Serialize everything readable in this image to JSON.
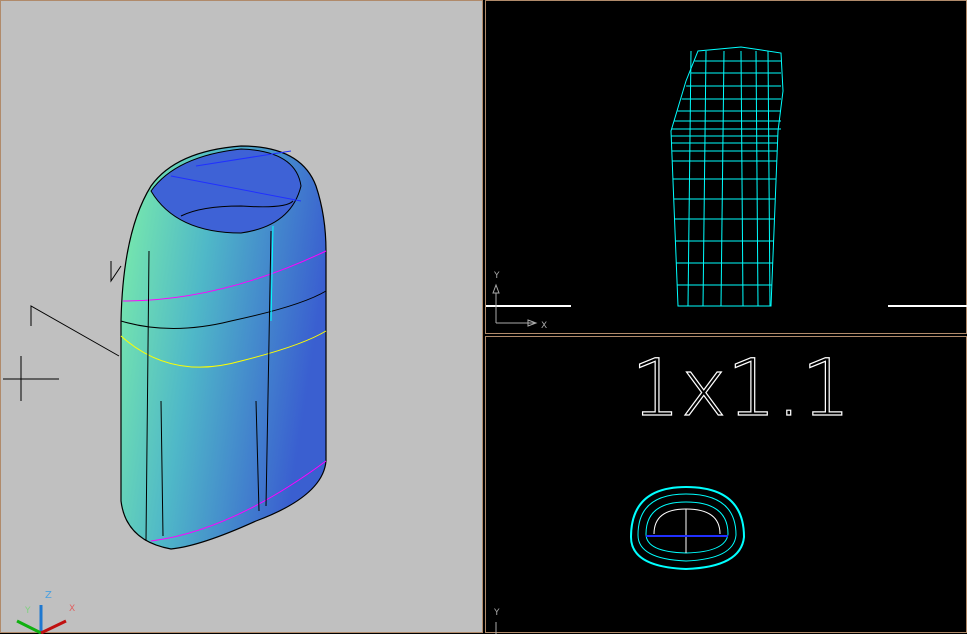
{
  "viewports": {
    "left": {
      "view": "3D shaded",
      "ucs_labels": {
        "x": "X",
        "y": "Y",
        "z": "Z"
      }
    },
    "top_right": {
      "view": "front wireframe",
      "ucs_labels": {
        "x": "X",
        "y": "Y"
      }
    },
    "bottom_right": {
      "view": "top wireframe",
      "annotation": "1x1.1",
      "ucs_labels": {
        "y": "Y"
      }
    }
  },
  "colors": {
    "left_bg": "#c0c0c0",
    "wire": "#00ffff",
    "border": "#b08a6a"
  }
}
